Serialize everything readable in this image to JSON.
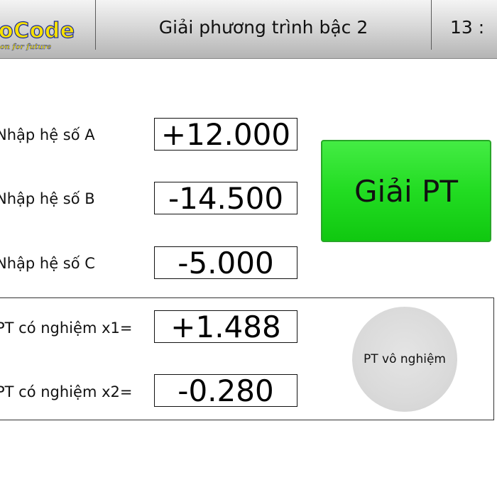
{
  "header": {
    "logo_text": "oCode",
    "logo_tagline": "on for future",
    "title": "Giải phương trình bậc 2",
    "time": "13 :"
  },
  "inputs": [
    {
      "label": "Nhập hệ số A",
      "value": "+12.000"
    },
    {
      "label": "Nhập hệ số B",
      "value": "-14.500"
    },
    {
      "label": "Nhập hệ số C",
      "value": "-5.000"
    }
  ],
  "solve_button": {
    "label": "Giải PT"
  },
  "results": [
    {
      "label": "PT có nghiệm x1=",
      "value": "+1.488"
    },
    {
      "label": "PT có nghiệm x2=",
      "value": "-0.280"
    }
  ],
  "status": {
    "text": "PT vô nghiệm"
  },
  "colors": {
    "button_green": "#22dc22",
    "lamp_gray": "#dadada",
    "logo_yellow": "#f7e000",
    "logo_outline": "#1a2a9a"
  }
}
